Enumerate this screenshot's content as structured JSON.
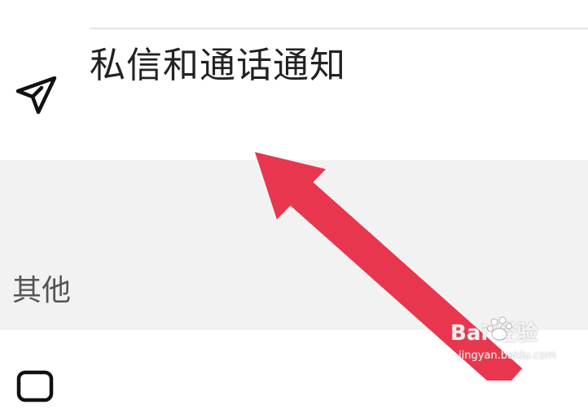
{
  "settings_list": {
    "dm_call_notifications": {
      "label": "私信和通话通知",
      "icon": "paper-plane-icon"
    },
    "other_section": {
      "header": "其他"
    },
    "next_item": {
      "icon": "chat-bubble-icon"
    }
  },
  "overlay": {
    "arrow_color": "#e8364e"
  },
  "watermark": {
    "brand": "Bai  经验",
    "url": "jingyan.baidu.com"
  }
}
